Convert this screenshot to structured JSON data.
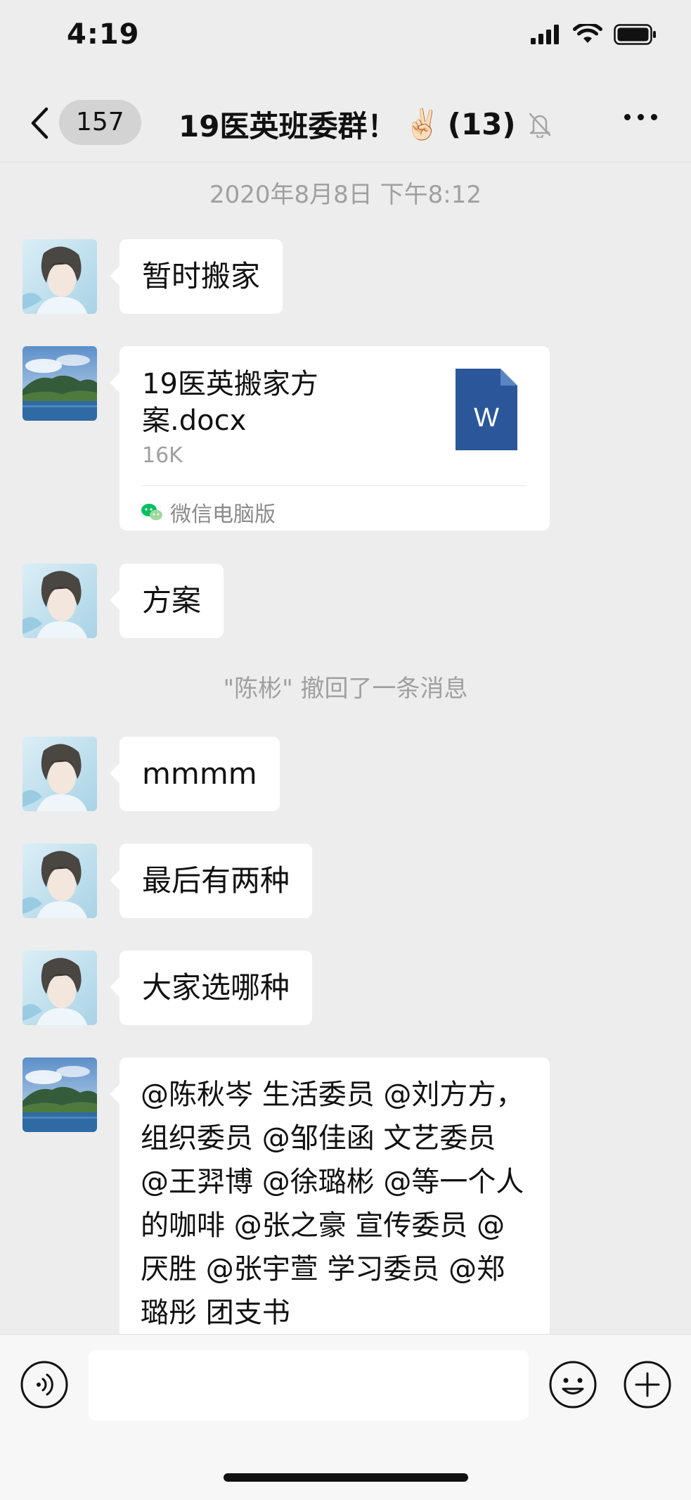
{
  "status_bar": {
    "time": "4:19"
  },
  "nav": {
    "unread_count": "157",
    "title": "19医英班委群！",
    "title_emoji": "✌🏻",
    "member_count": "(13)"
  },
  "chat": {
    "timestamp": "2020年8月8日 下午8:12",
    "messages": [
      {
        "text": "暂时搬家"
      },
      {
        "file_name": "19医英搬家方案.docx",
        "file_size": "16K",
        "file_icon_letter": "W",
        "source": "微信电脑版"
      },
      {
        "text": "方案"
      },
      {
        "system": "\"陈彬\" 撤回了一条消息"
      },
      {
        "text": "mmmm"
      },
      {
        "text": "最后有两种"
      },
      {
        "text": "大家选哪种"
      },
      {
        "text": "@陈秋岑 生活委员 @刘方方，组织委员 @邹佳函 文艺委员 @王羿博 @徐璐彬 @等一个人的咖啡 @张之豪 宣传委员 @厌胜 @张宇萱 学习委员 @郑璐彤 团支书"
      }
    ]
  },
  "colors": {
    "background": "#ededed",
    "bubble": "#ffffff",
    "word_icon": "#2b579a",
    "wechat_green": "#07c160"
  }
}
